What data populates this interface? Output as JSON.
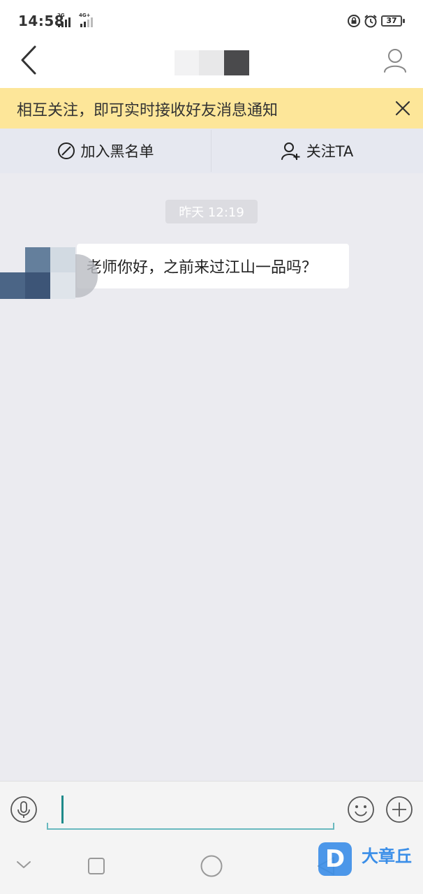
{
  "status_bar": {
    "time": "14:58",
    "signal1_label": "2G",
    "signal2_label": "4G+",
    "battery": "37",
    "icons": [
      "lock-rotation-icon",
      "alarm-icon"
    ]
  },
  "nav": {
    "back_icon": "chevron-left-icon",
    "profile_icon": "person-outline-icon"
  },
  "notice": {
    "text": "相互关注，即可实时接收好友消息通知",
    "close_icon": "close-icon"
  },
  "actions": {
    "blacklist_label": "加入黑名单",
    "blacklist_icon": "prohibit-icon",
    "follow_label": "关注TA",
    "follow_icon": "add-person-icon"
  },
  "chat": {
    "timestamp": "昨天 12:19",
    "messages": [
      {
        "text": "老师你好，之前来过江山一品吗？"
      }
    ]
  },
  "input_bar": {
    "voice_icon": "microphone-icon",
    "emoji_icon": "smiley-icon",
    "plus_icon": "plus-circle-icon",
    "value": ""
  },
  "watermark": {
    "logo_letter": "D",
    "text": "大章丘"
  },
  "colors": {
    "notice_bg": "#fde699",
    "action_bg": "#e6e8f0",
    "chat_bg": "#ebebf0",
    "input_accent": "#69b9bf",
    "watermark_blue": "#3a8ee8"
  }
}
